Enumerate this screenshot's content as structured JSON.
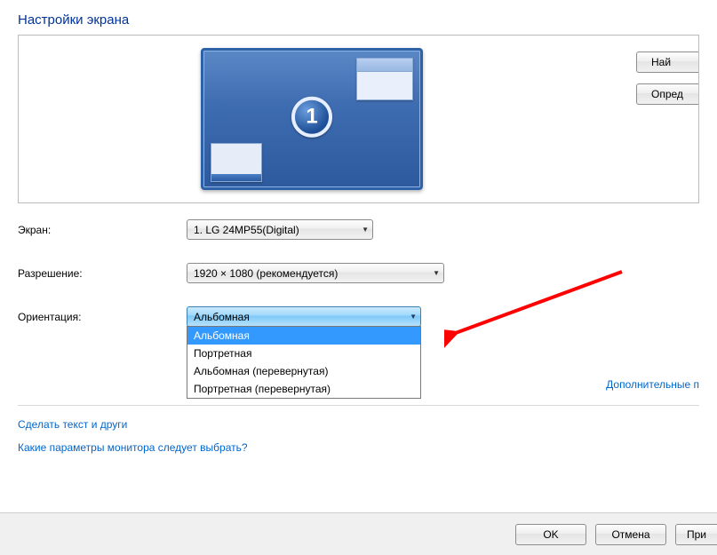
{
  "title": "Настройки экрана",
  "monitor_number": "1",
  "side_buttons": {
    "find": "Най",
    "detect": "Опред"
  },
  "form": {
    "screen_label": "Экран:",
    "screen_value": "1. LG 24MP55(Digital)",
    "resolution_label": "Разрешение:",
    "resolution_value": "1920 × 1080 (рекомендуется)",
    "orientation_label": "Ориентация:",
    "orientation_value": "Альбомная",
    "orientation_options": [
      "Альбомная",
      "Портретная",
      "Альбомная (перевернутая)",
      "Портретная (перевернутая)"
    ]
  },
  "links": {
    "advanced": "Дополнительные п",
    "resize_text": "Сделать текст и други",
    "help": "Какие параметры монитора следует выбрать?"
  },
  "buttons": {
    "ok": "OK",
    "cancel": "Отмена",
    "apply": "При"
  }
}
